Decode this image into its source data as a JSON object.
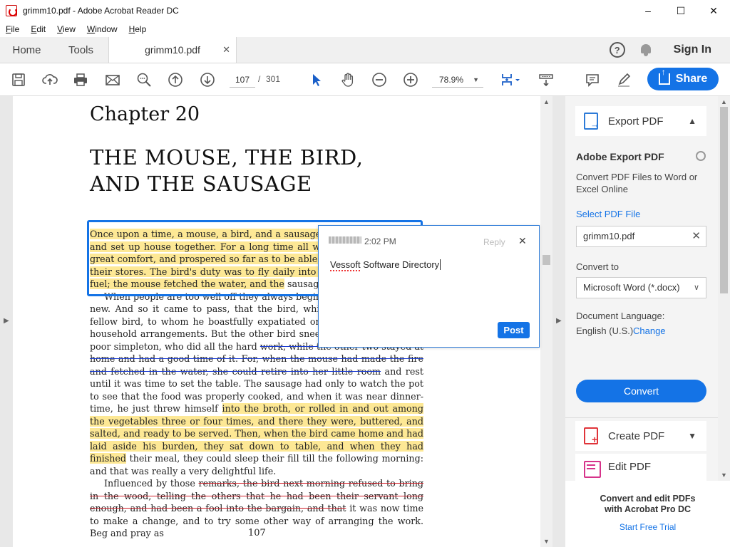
{
  "window": {
    "title": "grimm10.pdf - Adobe Acrobat Reader DC"
  },
  "menu": [
    "File",
    "Edit",
    "View",
    "Window",
    "Help"
  ],
  "tabs": {
    "home": "Home",
    "tools": "Tools",
    "document": "grimm10.pdf"
  },
  "header": {
    "sign_in": "Sign In"
  },
  "toolbar": {
    "page_current": "107",
    "page_separator": "/",
    "page_total": "301",
    "zoom": "78.9%",
    "share": "Share"
  },
  "page": {
    "chapter": "Chapter 20",
    "title_line1": "THE MOUSE, THE BIRD,",
    "title_line2": "AND THE SAUSAGE",
    "p1_hl": "Once upon a time, a mouse, a bird, and a sausage, became companions, and set up house together. For a long time all went well; they lived in great comfort, and prospered so far as to be able to add considerably to their stores. The bird's duty was to fly daily into the wood and bring in fuel; the mouse fetched the water, and the",
    "p1_rest": " sausage saw to the cooking.",
    "p2_a": "When people are too well off they always begin to long for something new. And so it came to pass, that the bird, while out one day, met a fellow bird, to whom he boastfully expatiated on the excellence of his household arrangements. But the other bird sneered at him for being a poor simpleton, who did all the hard ",
    "p2_strike": "work, while the other two stayed at home and had a good time of it. For, when the mouse had made the fire and fetched in the water, she could retire into her little room",
    "p2_b": " and rest until it was time to set the table. The sausage had only to watch the pot to see that the food was properly cooked, and when it was near dinner-time, he just threw himself ",
    "p2_hl": "into the broth, or rolled in and out among the vegetables three or four times, and there they were, buttered, and salted, and ready to be served. Then, when the bird came home and had laid aside his burden, they sat down to table, and when they had finished",
    "p2_c": " their meal, they could sleep their fill till the following morning: and that was really a very delightful life.",
    "p3_a": "Influenced by those ",
    "p3_strike": "remarks, the bird next morning refused to bring in the wood, telling the others that he had been their servant long enough, and had been a fool into the bargain, and that",
    "p3_b": " it was now time to make a change, and to try some other way of arranging the work. Beg and pray as",
    "page_number": "107"
  },
  "comment": {
    "time": "2:02 PM",
    "reply": "Reply",
    "text": "Vessoft Software Directory",
    "post": "Post"
  },
  "pane": {
    "export_header": "Export PDF",
    "title": "Adobe Export PDF",
    "description": "Convert PDF Files to Word or Excel Online",
    "select_label": "Select PDF File",
    "file_name": "grimm10.pdf",
    "convert_to_label": "Convert to",
    "format": "Microsoft Word (*.docx)",
    "language_label": "Document Language:",
    "language": "English (U.S.)",
    "change": "Change",
    "convert": "Convert",
    "create_pdf": "Create PDF",
    "edit_pdf": "Edit PDF"
  },
  "promo": {
    "line1": "Convert and edit PDFs",
    "line2": "with Acrobat Pro DC",
    "trial": "Start Free Trial"
  },
  "colors": {
    "accent": "#1473e6",
    "highlight": "#fde895",
    "strike_blue": "#1a3cd0",
    "strike_red": "#d0202a"
  },
  "icons": [
    "pdf-app-icon",
    "save-icon",
    "upload-icon",
    "print-icon",
    "mail-icon",
    "zoom-search-icon",
    "page-up-icon",
    "page-down-icon",
    "select-arrow-icon",
    "hand-icon",
    "zoom-out-icon",
    "zoom-in-icon",
    "fit-page-icon",
    "scroll-mode-icon",
    "comment-icon",
    "pen-icon",
    "share-icon",
    "help-icon",
    "bell-icon"
  ]
}
